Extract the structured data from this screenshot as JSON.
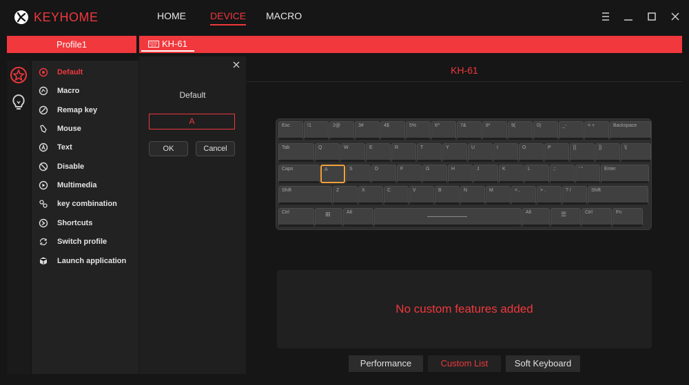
{
  "app": {
    "title": "KEYHOME"
  },
  "nav": {
    "home": "HOME",
    "device": "DEVICE",
    "macro": "MACRO"
  },
  "profile": {
    "name": "Profile1"
  },
  "device_tab": {
    "label": "KH-61"
  },
  "func_menu": [
    {
      "label": "Default",
      "icon": "target-icon",
      "active": true
    },
    {
      "label": "Macro",
      "icon": "macro-icon"
    },
    {
      "label": "Remap key",
      "icon": "remap-icon"
    },
    {
      "label": "Mouse",
      "icon": "mouse-icon"
    },
    {
      "label": "Text",
      "icon": "text-icon"
    },
    {
      "label": "Disable",
      "icon": "disable-icon"
    },
    {
      "label": "Multimedia",
      "icon": "play-icon"
    },
    {
      "label": "key combination",
      "icon": "link-icon"
    },
    {
      "label": "Shortcuts",
      "icon": "shortcut-icon"
    },
    {
      "label": "Switch profile",
      "icon": "switch-icon"
    },
    {
      "label": "Launch application",
      "icon": "app-icon"
    }
  ],
  "editor": {
    "label": "Default",
    "key_value": "A",
    "ok": "OK",
    "cancel": "Cancel"
  },
  "device": {
    "name": "KH-61"
  },
  "keyboard": {
    "rows": [
      [
        "Esc",
        "!1",
        "2@",
        "3#",
        "4$",
        "5%",
        "6^",
        "7&",
        "8*",
        "9(",
        "0)",
        "_-",
        "= +",
        "Backspace"
      ],
      [
        "Tab",
        "Q",
        "W",
        "E",
        "R",
        "T",
        "Y",
        "U",
        "I",
        "O",
        "P",
        "[{",
        "]}",
        "\\|"
      ],
      [
        "Caps",
        "A",
        "S",
        "D",
        "F",
        "G",
        "H",
        "J",
        "K",
        "L",
        ";:",
        "' \"",
        "Enter"
      ],
      [
        "Shift",
        "Z",
        "X",
        "C",
        "V",
        "B",
        "N",
        "M",
        "< ,",
        "> .",
        "? /",
        "Shift"
      ],
      [
        "Ctrl",
        "win-icon",
        "Alt",
        "",
        "Alt",
        "menu-icon",
        "Ctrl",
        "Fn"
      ]
    ],
    "selected_key": "A"
  },
  "message": "No custom features added",
  "bottom_tabs": {
    "performance": "Performance",
    "custom_list": "Custom List",
    "soft_keyboard": "Soft Keyboard"
  },
  "colors": {
    "accent": "#f0383d",
    "selected_key": "#f3a23a"
  }
}
